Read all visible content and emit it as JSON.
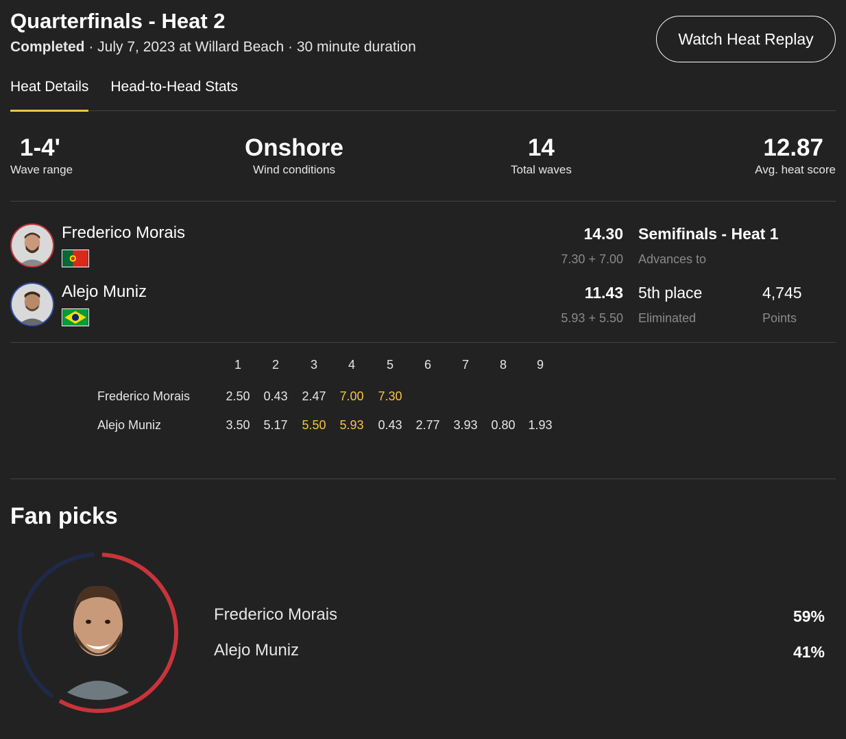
{
  "header": {
    "title": "Quarterfinals - Heat 2",
    "status": "Completed",
    "details": " · July 7, 2023 at Willard Beach · 30 minute duration",
    "replay_label": "Watch Heat Replay"
  },
  "tabs": [
    {
      "label": "Heat Details",
      "active": true
    },
    {
      "label": "Head-to-Head Stats",
      "active": false
    }
  ],
  "stats": [
    {
      "value": "1-4'",
      "label": "Wave range"
    },
    {
      "value": "Onshore",
      "label": "Wind conditions"
    },
    {
      "value": "14",
      "label": "Total waves"
    },
    {
      "value": "12.87",
      "label": "Avg. heat score"
    }
  ],
  "surfers": [
    {
      "name": "Frederico Morais",
      "country": "Portugal",
      "ring_color": "#c8343a",
      "score": "14.30",
      "waves": "7.30 + 7.00",
      "result": "Semifinals - Heat 1",
      "result_sub": "Advances to",
      "points": "",
      "points_sub": ""
    },
    {
      "name": "Alejo Muniz",
      "country": "Brazil",
      "ring_color": "#2f4fa8",
      "score": "11.43",
      "waves": "5.93 + 5.50",
      "result": "5th place",
      "result_sub": "Eliminated",
      "points": "4,745",
      "points_sub": "Points"
    }
  ],
  "wave_table": {
    "columns": [
      "1",
      "2",
      "3",
      "4",
      "5",
      "6",
      "7",
      "8",
      "9"
    ],
    "rows": [
      {
        "name": "Frederico Morais",
        "scores": [
          "2.50",
          "0.43",
          "2.47",
          "7.00",
          "7.30"
        ],
        "highlight": [
          3,
          4
        ]
      },
      {
        "name": "Alejo Muniz",
        "scores": [
          "3.50",
          "5.17",
          "5.50",
          "5.93",
          "0.43",
          "2.77",
          "3.93",
          "0.80",
          "1.93"
        ],
        "highlight": [
          2,
          3
        ]
      }
    ],
    "highlight_color": "#f5c542"
  },
  "fan_picks": {
    "title": "Fan picks",
    "picks": [
      {
        "name": "Frederico Morais",
        "pct": "59%",
        "fraction": 0.59,
        "color": "#c8343a"
      },
      {
        "name": "Alejo Muniz",
        "pct": "41%",
        "fraction": 0.41,
        "color": "#1f2a4a"
      }
    ]
  },
  "colors": {
    "background": "#222222",
    "accent": "#f5c542",
    "red": "#c8343a",
    "blue": "#2f4fa8"
  }
}
